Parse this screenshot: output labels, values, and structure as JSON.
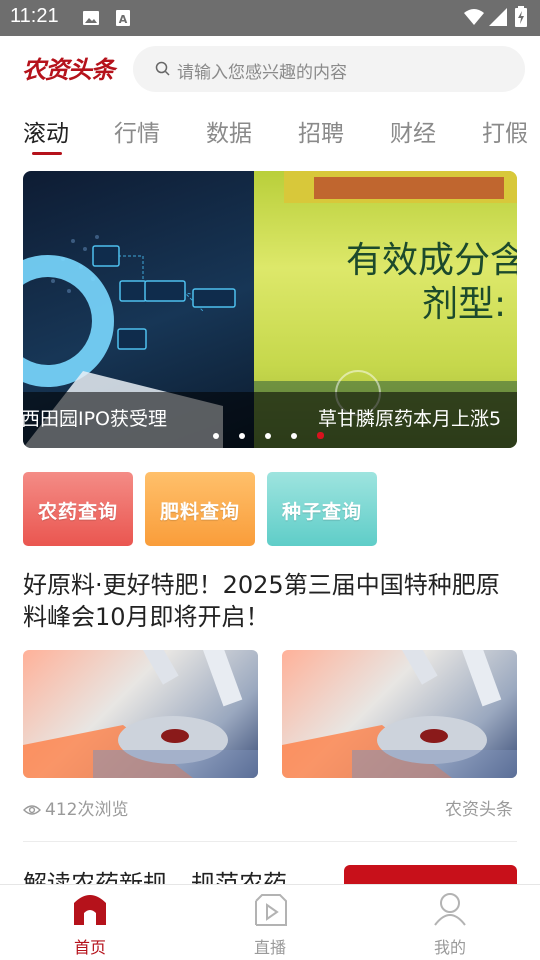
{
  "status_bar": {
    "time": "11:21",
    "icons": [
      "image-icon",
      "a-notification-icon",
      "wifi-icon",
      "signal-icon",
      "battery-icon"
    ]
  },
  "header": {
    "logo_text": "农资头条",
    "search_placeholder": "请输入您感兴趣的内容"
  },
  "tabs": [
    {
      "label": "滚动",
      "active": true
    },
    {
      "label": "行情"
    },
    {
      "label": "数据"
    },
    {
      "label": "招聘"
    },
    {
      "label": "财经"
    },
    {
      "label": "打假"
    }
  ],
  "banner": {
    "slides": [
      {
        "caption": "西田园IPO获受理"
      },
      {
        "caption": "草甘膦原药本月上涨5"
      }
    ],
    "slide2_image_text": {
      "line1": "有效成分含",
      "line2": "剂型:"
    },
    "dots": 5,
    "active_dot": 4
  },
  "quick_links": [
    {
      "label": "农药查询"
    },
    {
      "label": "肥料查询"
    },
    {
      "label": "种子查询"
    }
  ],
  "article": {
    "title": "好原料·更好特肥！2025第三届中国特种肥原料峰会10月即将开启！",
    "views": "412次浏览",
    "source": "农资头条"
  },
  "next_article": {
    "title": "解读农药新规，规范农药"
  },
  "bottom_nav": [
    {
      "label": "首页",
      "icon": "home-icon",
      "active": true
    },
    {
      "label": "直播",
      "icon": "live-icon"
    },
    {
      "label": "我的",
      "icon": "profile-icon"
    }
  ],
  "colors": {
    "brand": "#b5121b",
    "muted": "#9a9a9a"
  }
}
